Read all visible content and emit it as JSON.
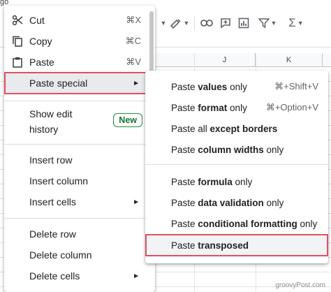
{
  "toolbar": {
    "corner_text": "go",
    "icons": [
      "paint-format-icon",
      "link-icon",
      "comment-icon",
      "chart-icon",
      "filter-icon",
      "functions-icon"
    ]
  },
  "columns": [
    "J",
    "K"
  ],
  "context_menu": {
    "items": [
      {
        "icon": "cut-icon",
        "label": "Cut",
        "shortcut": "⌘X"
      },
      {
        "icon": "copy-icon",
        "label": "Copy",
        "shortcut": "⌘C"
      },
      {
        "icon": "paste-icon",
        "label": "Paste",
        "shortcut": "⌘V"
      },
      {
        "label": "Paste special",
        "arrow": "►"
      },
      {
        "label_line1": "Show edit",
        "label_line2": "history",
        "badge": "New"
      },
      {
        "label": "Insert row"
      },
      {
        "label": "Insert column"
      },
      {
        "label": "Insert cells",
        "arrow": "►"
      },
      {
        "label": "Delete row"
      },
      {
        "label": "Delete column"
      },
      {
        "label": "Delete cells",
        "arrow": "►"
      }
    ]
  },
  "paste_special_menu": {
    "items": [
      {
        "pre": "Paste ",
        "bold": "values",
        "post": " only",
        "shortcut": "⌘+Shift+V"
      },
      {
        "pre": "Paste ",
        "bold": "format",
        "post": " only",
        "shortcut": "⌘+Option+V"
      },
      {
        "pre": "Paste all ",
        "bold": "except borders",
        "post": ""
      },
      {
        "pre": "Paste ",
        "bold": "column widths",
        "post": " only"
      },
      {
        "pre": "Paste ",
        "bold": "formula",
        "post": " only"
      },
      {
        "pre": "Paste ",
        "bold": "data validation",
        "post": " only"
      },
      {
        "pre": "Paste ",
        "bold": "conditional formatting",
        "post": " only"
      },
      {
        "pre": "Paste ",
        "bold": "transposed",
        "post": ""
      }
    ]
  },
  "watermark": "groovyPost.com",
  "colors": {
    "highlight_border": "#e0515f",
    "badge_green": "#137333"
  }
}
